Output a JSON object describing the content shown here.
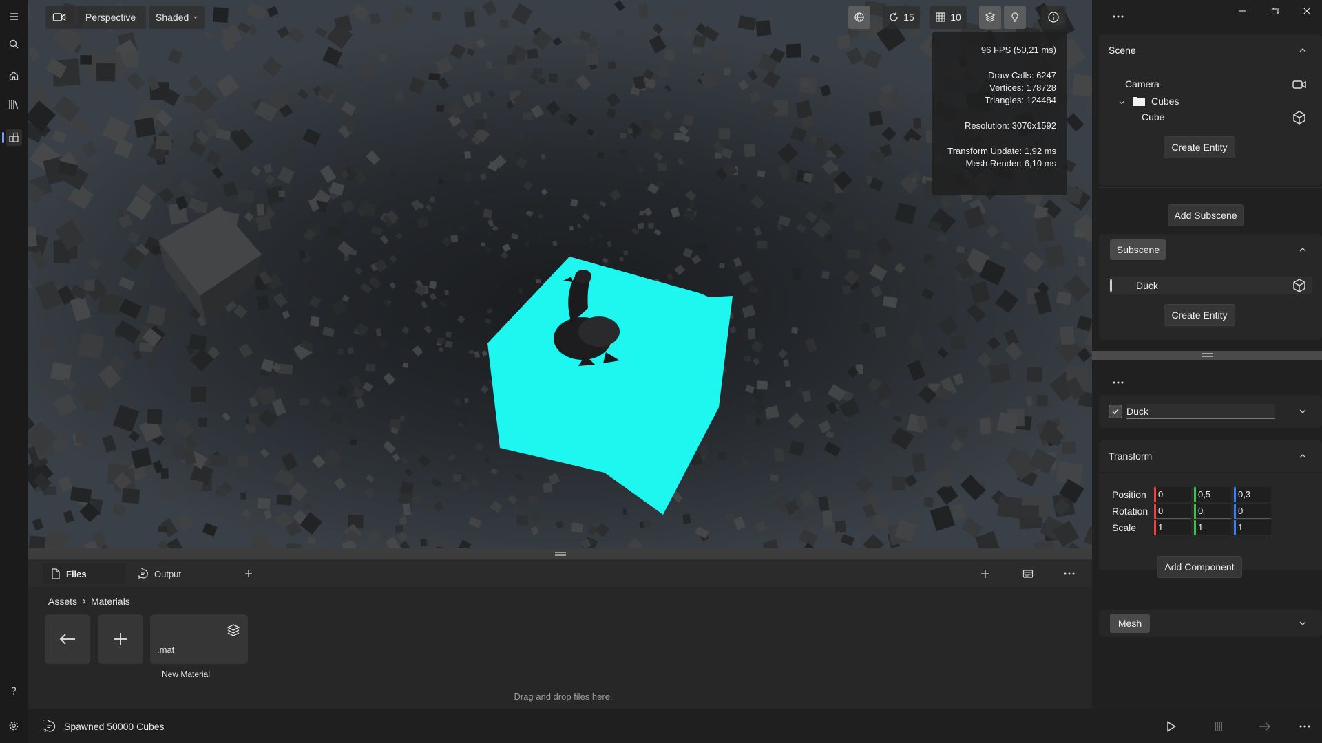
{
  "viewport": {
    "projection": "Perspective",
    "shading": "Shaded",
    "counter_a": "15",
    "counter_b": "10",
    "stats": {
      "fps": "96 FPS (50,21 ms)",
      "draw_calls": "Draw Calls: 6247",
      "vertices": "Vertices: 178728",
      "triangles": "Triangles: 124484",
      "resolution": "Resolution: 3076x1592",
      "transform_update": "Transform Update: 1,92 ms",
      "mesh_render": "Mesh Render: 6,10 ms"
    },
    "selection_color": "#1ef6f0"
  },
  "bottom": {
    "tabs": [
      "Files",
      "Output"
    ],
    "breadcrumb": [
      "Assets",
      "Materials"
    ],
    "tile_ext": ".mat",
    "tile_name": "New Material",
    "drop_hint": "Drag and drop files here."
  },
  "status": {
    "message": "Spawned 50000 Cubes"
  },
  "scene": {
    "title": "Scene",
    "items": [
      {
        "label": "Camera",
        "icon": "camera-icon"
      },
      {
        "label": "Cubes",
        "icon": "folder-icon"
      },
      {
        "label": "Cube",
        "icon": "cube-icon"
      }
    ],
    "create_entity": "Create Entity",
    "add_subscene": "Add Subscene"
  },
  "subscene": {
    "title": "Subscene",
    "items": [
      {
        "label": "Duck",
        "icon": "cube-icon"
      }
    ],
    "create_entity": "Create Entity"
  },
  "inspector": {
    "entity_name": "Duck",
    "entity_enabled": true,
    "transform_title": "Transform",
    "rows": [
      {
        "label": "Position",
        "values": [
          "0",
          "0,5",
          "0,3"
        ]
      },
      {
        "label": "Rotation",
        "values": [
          "0",
          "0",
          "0"
        ]
      },
      {
        "label": "Scale",
        "values": [
          "1",
          "1",
          "1"
        ]
      }
    ],
    "axis_colors": [
      "#e8473d",
      "#3fbf4f",
      "#3c7fe8"
    ],
    "add_component": "Add Component",
    "mesh_label": "Mesh"
  }
}
